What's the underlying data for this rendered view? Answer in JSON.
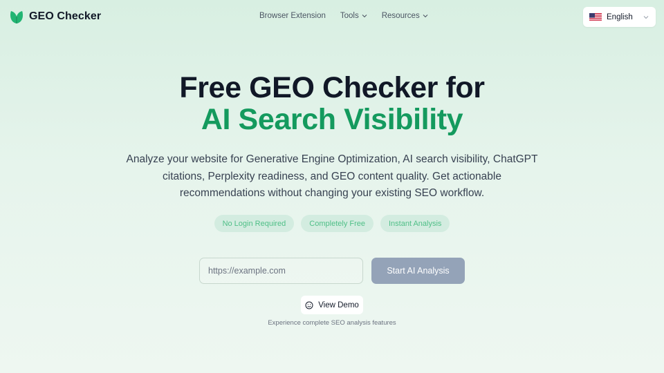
{
  "header": {
    "brand_name": "GEO Checker",
    "brand_icon": "leaf-icon",
    "nav": {
      "browser_extension": "Browser Extension",
      "tools": "Tools",
      "resources": "Resources"
    },
    "language": {
      "selected": "English",
      "flag_icon": "us-flag-icon"
    }
  },
  "hero": {
    "title_line1": "Free GEO Checker for",
    "title_line2": "AI Search Visibility",
    "description": "Analyze your website for Generative Engine Optimization, AI search visibility, ChatGPT citations, Perplexity readiness, and GEO content quality. Get actionable recommendations without changing your existing SEO workflow.",
    "badges": [
      "No Login Required",
      "Completely Free",
      "Instant Analysis"
    ]
  },
  "form": {
    "url_placeholder": "https://example.com",
    "url_value": "",
    "submit_label": "Start AI Analysis"
  },
  "demo": {
    "label": "View Demo",
    "icon": "smile-icon",
    "note": "Experience complete SEO analysis features"
  },
  "colors": {
    "accent": "#149a5e",
    "badge_bg": "#d3ece0",
    "badge_text": "#4fbf87",
    "button_disabled": "#94a3b8",
    "heading": "#111827"
  }
}
